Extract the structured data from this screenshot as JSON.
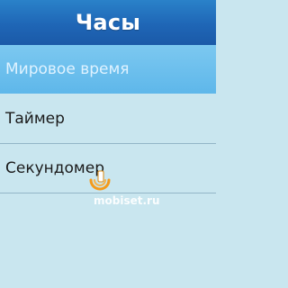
{
  "header": {
    "title": "Часы"
  },
  "menu": {
    "items": [
      {
        "label": "Мировое время",
        "selected": true
      },
      {
        "label": "Таймер",
        "selected": false
      },
      {
        "label": "Секундомер",
        "selected": false
      }
    ]
  },
  "watermark": {
    "text": "mobiset.ru",
    "logo_icon": "phone-wave-icon"
  },
  "colors": {
    "header": "#1f66b6",
    "selected": "#5eb7ea",
    "background": "#c9e6ef"
  }
}
